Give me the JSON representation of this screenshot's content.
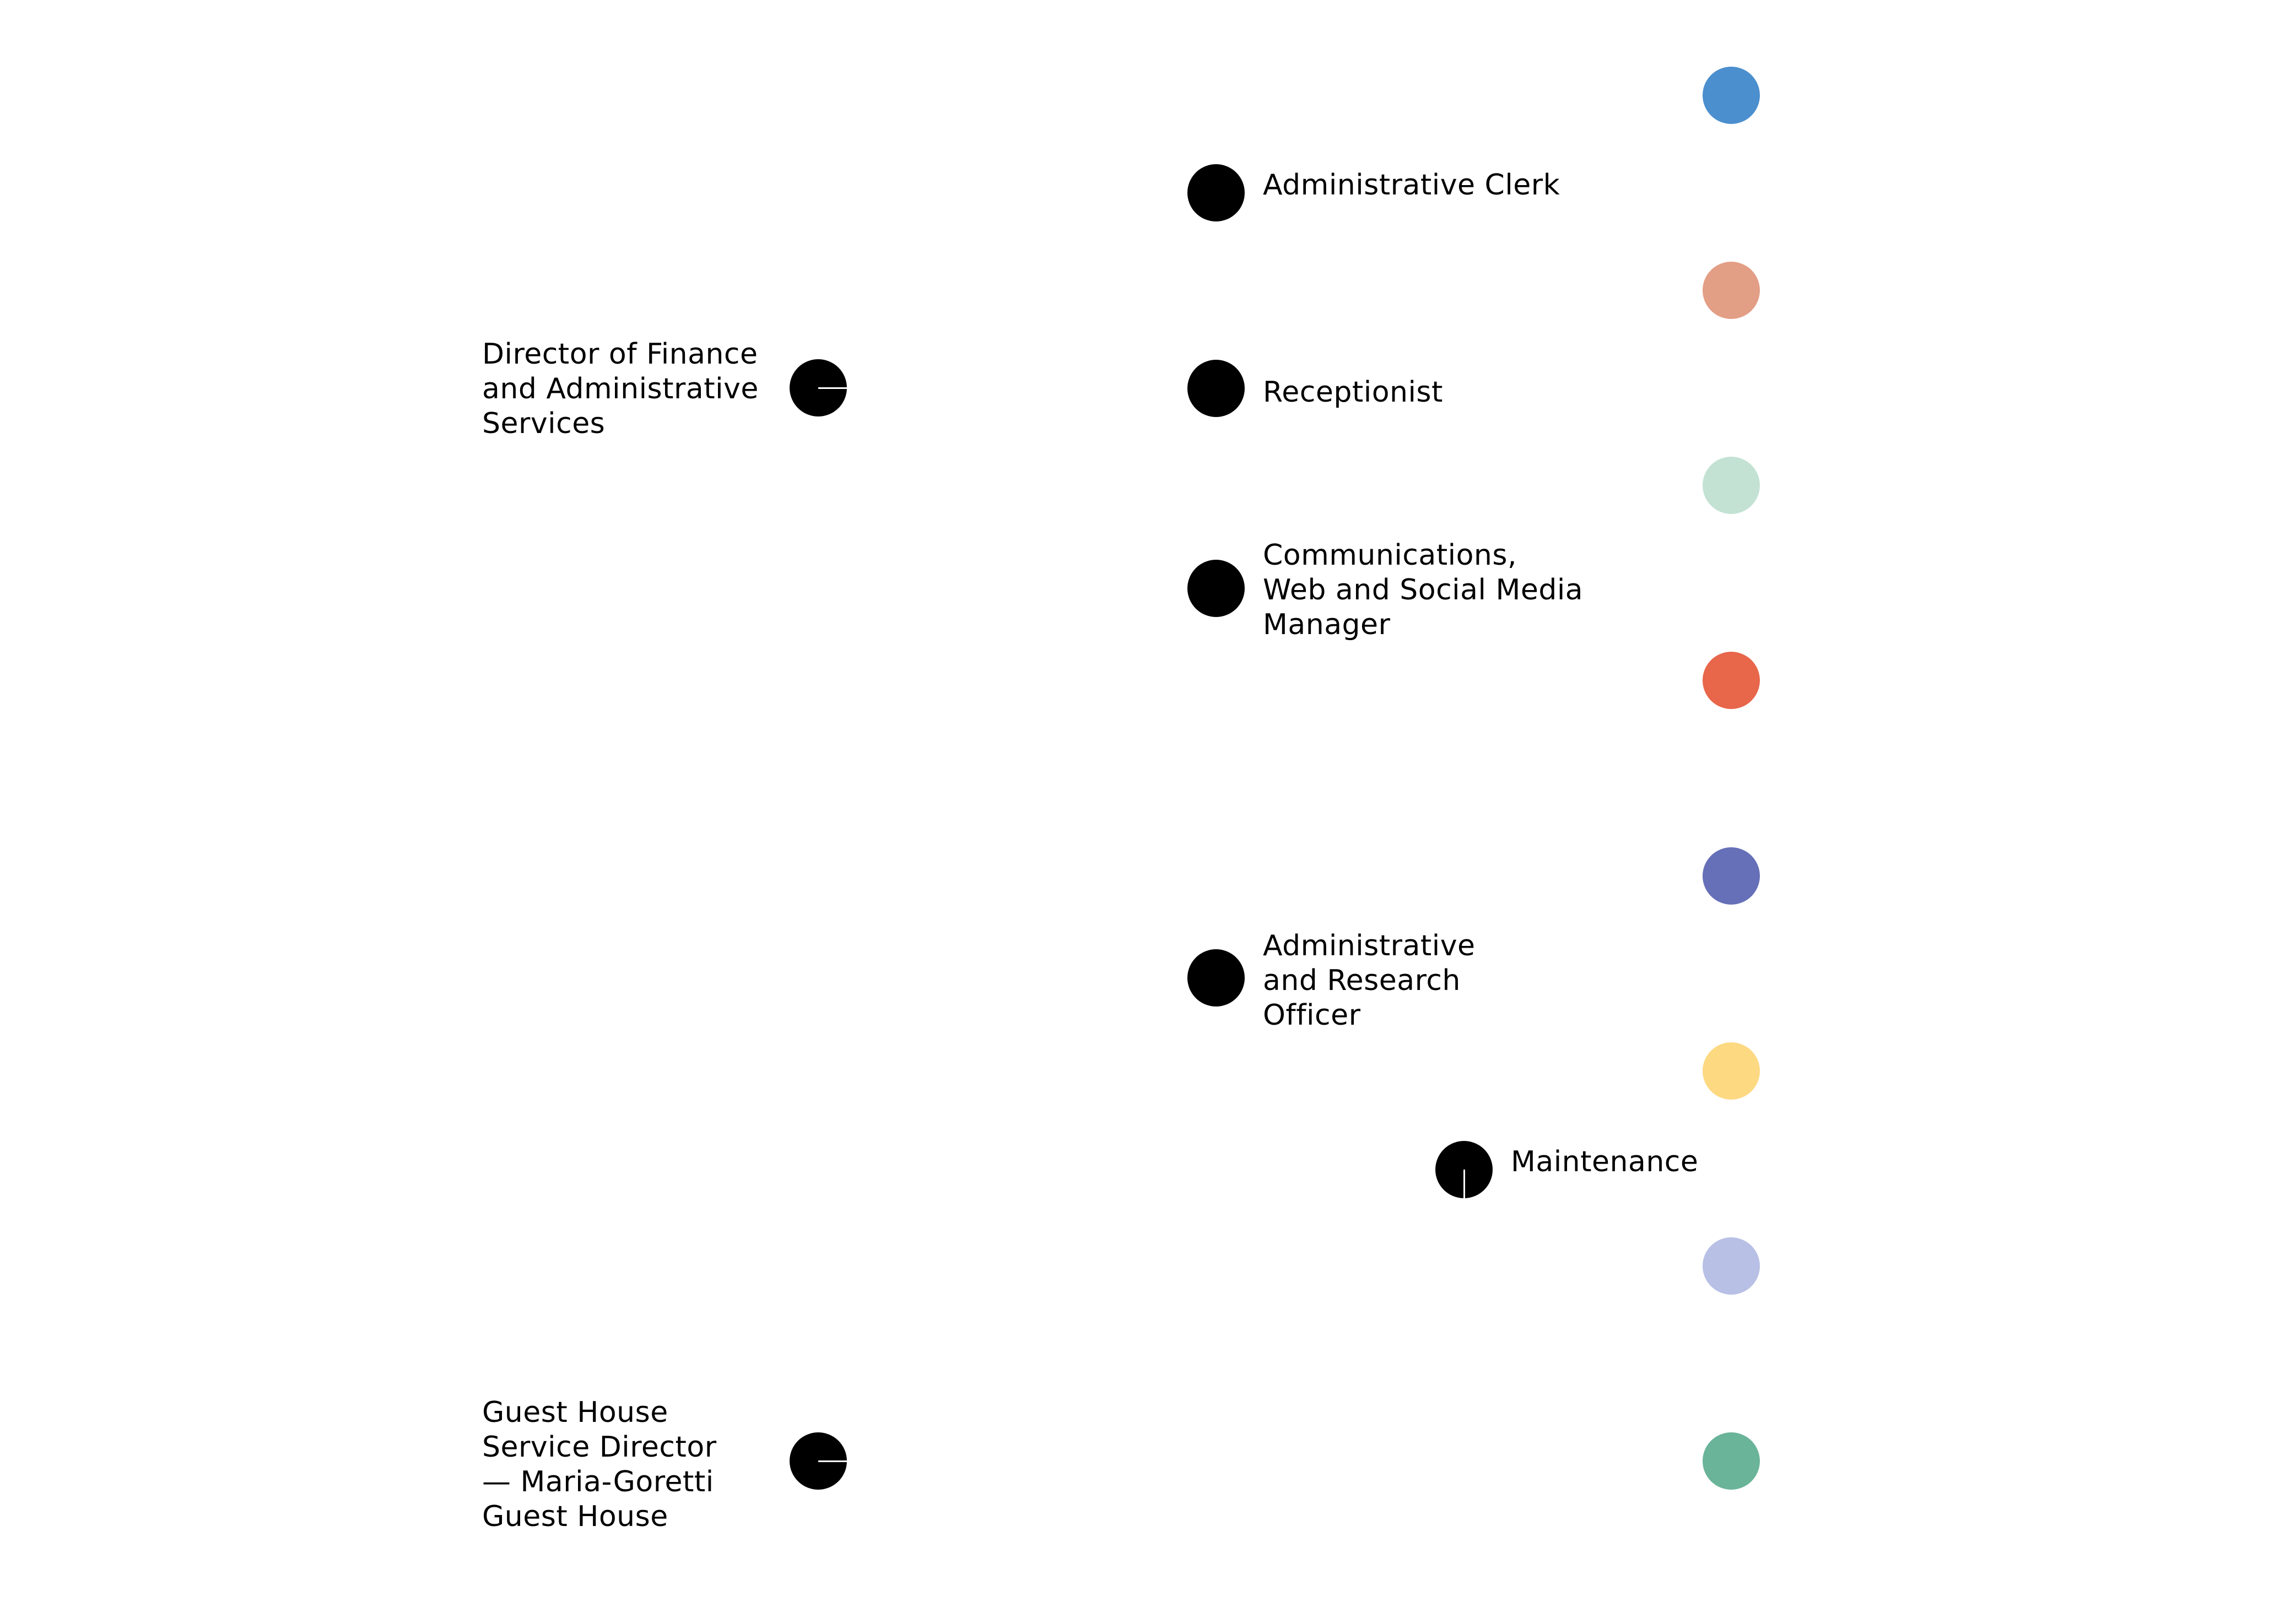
{
  "nodes": [
    {
      "id": "director-finance",
      "lines": [
        "Director of Finance",
        "and Administrative",
        "Services"
      ]
    },
    {
      "id": "guest-house-director",
      "lines": [
        "Guest House",
        "Service Director",
        "— Maria-Goretti",
        "Guest House"
      ]
    },
    {
      "id": "administrative-clerk",
      "lines": [
        "Administrative Clerk"
      ]
    },
    {
      "id": "receptionist",
      "lines": [
        "Receptionist"
      ]
    },
    {
      "id": "communications-manager",
      "lines": [
        "Communications,",
        "Web and Social Media",
        "Manager"
      ]
    },
    {
      "id": "research-officer",
      "lines": [
        "Administrative",
        "and Research",
        "Officer"
      ]
    },
    {
      "id": "maintenance",
      "lines": [
        "Maintenance"
      ]
    }
  ],
  "color_dots": [
    "#4b8fce",
    "#e39e86",
    "#c3e2d4",
    "#e8664a",
    "#6670b8",
    "#fdd982",
    "#b8c0e5",
    "#6ab49a"
  ]
}
